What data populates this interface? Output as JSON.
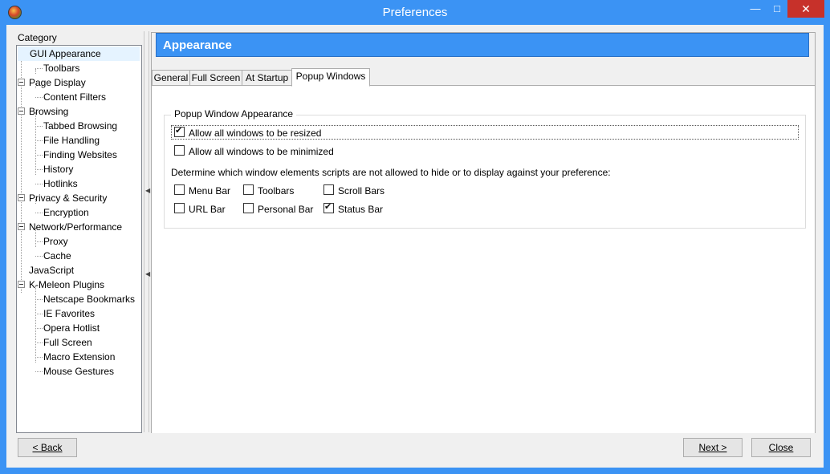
{
  "window": {
    "title": "Preferences",
    "minimize_glyph": "—",
    "maximize_glyph": "□",
    "close_glyph": "✕"
  },
  "category": {
    "label": "Category",
    "items": [
      {
        "label": "GUI Appearance",
        "level": 0,
        "expander": true
      },
      {
        "label": "Toolbars",
        "level": 1
      },
      {
        "label": "Page Display",
        "level": 0,
        "expander": true
      },
      {
        "label": "Content Filters",
        "level": 1
      },
      {
        "label": "Browsing",
        "level": 0,
        "expander": true
      },
      {
        "label": "Tabbed Browsing",
        "level": 1
      },
      {
        "label": "File Handling",
        "level": 1
      },
      {
        "label": "Finding Websites",
        "level": 1
      },
      {
        "label": "History",
        "level": 1
      },
      {
        "label": "Hotlinks",
        "level": 1
      },
      {
        "label": "Privacy & Security",
        "level": 0,
        "expander": true
      },
      {
        "label": "Encryption",
        "level": 1
      },
      {
        "label": "Network/Performance",
        "level": 0,
        "expander": true
      },
      {
        "label": "Proxy",
        "level": 1
      },
      {
        "label": "Cache",
        "level": 1
      },
      {
        "label": "JavaScript",
        "level": 0
      },
      {
        "label": "K-Meleon Plugins",
        "level": 0,
        "expander": true
      },
      {
        "label": "Netscape Bookmarks",
        "level": 1
      },
      {
        "label": "IE Favorites",
        "level": 1
      },
      {
        "label": "Opera Hotlist",
        "level": 1
      },
      {
        "label": "Full Screen",
        "level": 1
      },
      {
        "label": "Macro Extension",
        "level": 1
      },
      {
        "label": "Mouse Gestures",
        "level": 1
      }
    ],
    "selected": "GUI Appearance"
  },
  "panel": {
    "header": "Appearance",
    "tabs": [
      "General",
      "Full Screen",
      "At Startup",
      "Popup Windows"
    ],
    "active_tab": "Popup Windows",
    "group_title": "Popup Window Appearance",
    "allow_resize": {
      "label": "Allow all windows to be resized",
      "checked": true
    },
    "allow_minimize": {
      "label": "Allow all windows to be minimized",
      "checked": false
    },
    "instruction": "Determine which window elements scripts are not allowed to hide or to display against your preference:",
    "elements": [
      {
        "label": "Menu Bar",
        "checked": false
      },
      {
        "label": "Toolbars",
        "checked": false
      },
      {
        "label": "Scroll Bars",
        "checked": false
      },
      {
        "label": "URL Bar",
        "checked": false
      },
      {
        "label": "Personal Bar",
        "checked": false
      },
      {
        "label": "Status Bar",
        "checked": true
      }
    ]
  },
  "buttons": {
    "back": "< Back",
    "next": "Next >",
    "close": "Close"
  },
  "colors": {
    "titlebar": "#3b93f4",
    "header": "#3b93f4",
    "close_button": "#c7312a"
  }
}
